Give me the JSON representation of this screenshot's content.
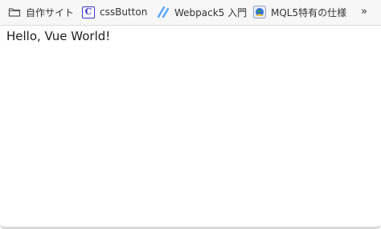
{
  "bookmarks_bar": {
    "items": [
      {
        "label": "自作サイト",
        "icon": "folder-icon"
      },
      {
        "label": "cssButton",
        "icon": "css-icon",
        "icon_glyph": "C"
      },
      {
        "label": "Webpack5 入門",
        "icon": "webpack-slash-icon"
      },
      {
        "label": "MQL5特有の仕様",
        "icon": "mql5-globe-icon"
      }
    ],
    "overflow": "»"
  },
  "page": {
    "heading": "Hello, Vue World!"
  },
  "colors": {
    "css_icon": "#3a34c9",
    "webpack_icon": "#5da8ff",
    "mql_icon_blue": "#2f6fd1",
    "mql_icon_yellow": "#f1c232"
  }
}
